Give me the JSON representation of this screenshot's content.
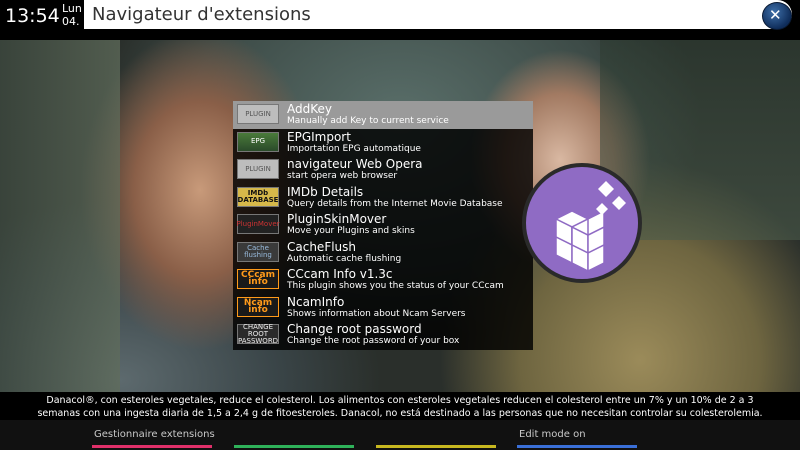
{
  "header": {
    "time": "13:54",
    "day": "Lun",
    "date": "04.",
    "title": "Navigateur d'extensions",
    "logo_icon": "satellite-logo-icon"
  },
  "plugins": [
    {
      "thumb": "PLUGIN",
      "title": "AddKey",
      "desc": "Manually add Key to current service",
      "selected": true
    },
    {
      "thumb": "EPG",
      "title": "EPGImport",
      "desc": "Importation EPG automatique",
      "selected": false
    },
    {
      "thumb": "PLUGIN",
      "title": "navigateur Web Opera",
      "desc": "start opera web browser",
      "selected": false
    },
    {
      "thumb": "IMDb DATABASE",
      "title": "IMDb Details",
      "desc": "Query details from the Internet Movie Database",
      "selected": false
    },
    {
      "thumb": "PluginMover",
      "title": "PluginSkinMover",
      "desc": "Move your Plugins and skins",
      "selected": false
    },
    {
      "thumb": "Cache flushing",
      "title": "CacheFlush",
      "desc": "Automatic cache flushing",
      "selected": false
    },
    {
      "thumb": "CCcam info",
      "title": "CCcam Info v1.3c",
      "desc": "This plugin shows you the status of your CCcam",
      "selected": false
    },
    {
      "thumb": "Ncam info",
      "title": "NcamInfo",
      "desc": "Shows information about Ncam Servers",
      "selected": false
    },
    {
      "thumb": "CHANGE ROOT PASSWORD",
      "title": "Change root password",
      "desc": "Change the root password of your box",
      "selected": false
    }
  ],
  "ticker": {
    "line1": "Danacol®, con esteroles vegetales, reduce el colesterol. Los alimentos con esteroles vegetales reducen el colesterol entre un 7% y un 10% de 2 a 3",
    "line2": "semanas con una ingesta diaria de 1,5 a 2,4 g de fitoesteroles. Danacol, no está destinado a las personas que no necesitan controlar su colesterolemia."
  },
  "buttons": {
    "red": "Gestionnaire extensions",
    "green": "",
    "yellow": "",
    "blue": "Edit mode on"
  },
  "colors": {
    "red": "#e0306a",
    "green": "#2fb25a",
    "yellow": "#c8b820",
    "blue": "#3a6fd8",
    "selection": "#9a9a9a",
    "cube_bg": "#8f6bc4"
  }
}
